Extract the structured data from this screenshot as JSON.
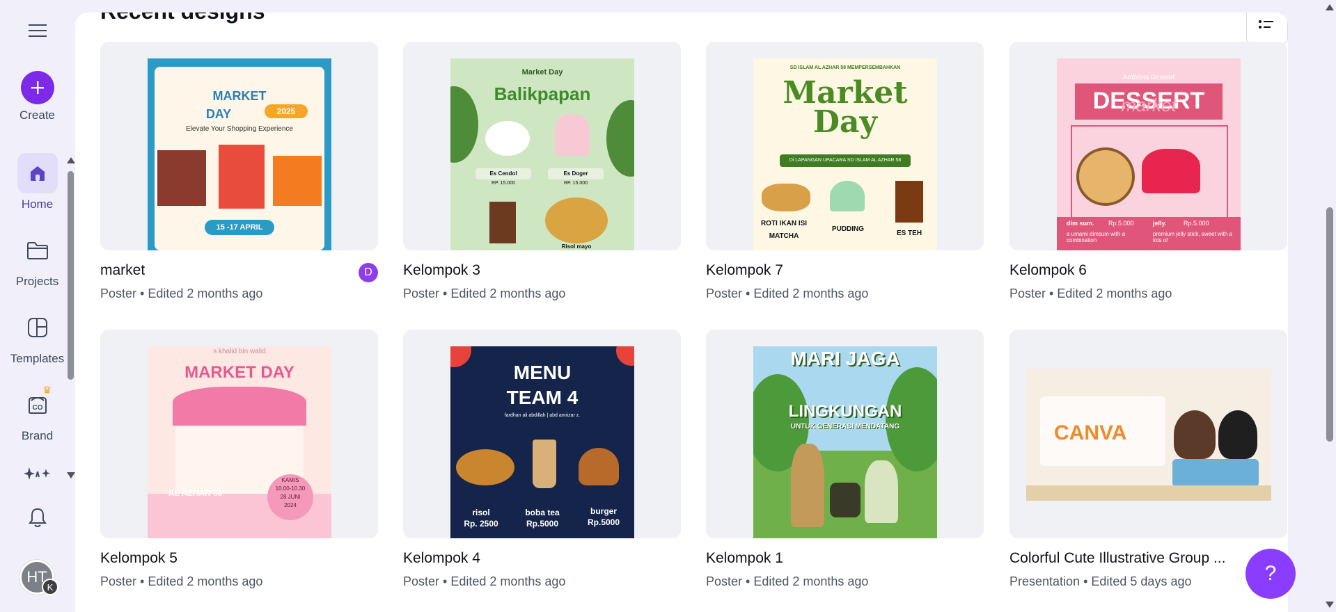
{
  "sidebar": {
    "menu_icon": "hamburger-icon",
    "items": [
      {
        "label": "Create",
        "icon": "plus-icon"
      },
      {
        "label": "Home",
        "icon": "home-icon"
      },
      {
        "label": "Projects",
        "icon": "folder-icon"
      },
      {
        "label": "Templates",
        "icon": "templates-icon"
      },
      {
        "label": "Brand",
        "icon": "brand-icon"
      },
      {
        "label": "",
        "icon": "sparkles-icon"
      },
      {
        "label": "",
        "icon": "bell-icon"
      }
    ],
    "avatar": {
      "initials": "HT",
      "badge": "K"
    }
  },
  "main": {
    "section_title": "Recent designs",
    "designs": [
      {
        "title": "market",
        "meta": "Poster • Edited 2 months ago",
        "owner_badge": "D",
        "thumb": {
          "l1": "MARKET",
          "l2": "DAY",
          "year": "2025",
          "tagline": "Elevate Your Shopping Experience",
          "date": "15 -17 APRIL"
        }
      },
      {
        "title": "Kelompok 3",
        "meta": "Poster • Edited 2 months ago",
        "thumb": {
          "top": "Market Day",
          "heading": "Balikpapan",
          "item1": "Es Cendol",
          "item2": "Es Doger",
          "price1": "RP. 15.000",
          "price2": "RP. 15.000",
          "item3": "Risol mayo"
        }
      },
      {
        "title": "Kelompok 7",
        "meta": "Poster • Edited 2 months ago",
        "thumb": {
          "top": "SD ISLAM AL AZHAR 58 MEMPERSEMBAHKAN",
          "l1": "Market",
          "l2": "Day",
          "bar": "Di LAPANGAN UPACARA SD ISLAM AL AZHAR 58",
          "item1": "ROTI IKAN ISI",
          "item1b": "MATCHA",
          "item2": "PUDDING",
          "item3": "ES TEH"
        }
      },
      {
        "title": "Kelompok 6",
        "meta": "Poster • Edited 2 months ago",
        "thumb": {
          "top": "Amberia Dessert",
          "heading": "DESSERT",
          "script": "market",
          "c1": "dim sum.",
          "p1": "Rp.5.000",
          "c2": "jelly.",
          "p2": "Rp.5.000",
          "d1": "a umami dimsum with a combination",
          "d2": "premium jelly stick, sweet with a lots of"
        }
      },
      {
        "title": "Kelompok 5",
        "meta": "Poster • Edited 2 months ago",
        "thumb": {
          "top": "s khalid bin walid",
          "heading": "MARKET DAY",
          "school": "AL AZHAR 58",
          "day": "KAMIS",
          "time": "10.00-10.30",
          "date": "28 JUNI",
          "year": "2024"
        }
      },
      {
        "title": "Kelompok 4",
        "meta": "Poster • Edited 2 months ago",
        "thumb": {
          "l1": "MENU",
          "l2": "TEAM 4",
          "names": "fardhan ali abdillah | abd annizar z.",
          "i1": "risol",
          "p1": "Rp. 2500",
          "i2": "boba tea",
          "p2": "Rp.5000",
          "i3": "burger",
          "p3": "Rp.5000"
        }
      },
      {
        "title": "Kelompok 1",
        "meta": "Poster • Edited 2 months ago",
        "thumb": {
          "l1": "MARI JAGA",
          "l2": "LINGKUNGAN",
          "l3": "UNTUK GENERASI MENDATANG"
        }
      },
      {
        "title": "Colorful Cute Illustrative  Group ...",
        "meta": "Presentation • Edited 5 days ago",
        "thumb": {
          "heading": "CANVA"
        }
      }
    ]
  },
  "help_button": "?",
  "colors": {
    "accent": "#8b3dff",
    "create": "#7d2ae8",
    "rail_bg": "#f1eff9"
  }
}
